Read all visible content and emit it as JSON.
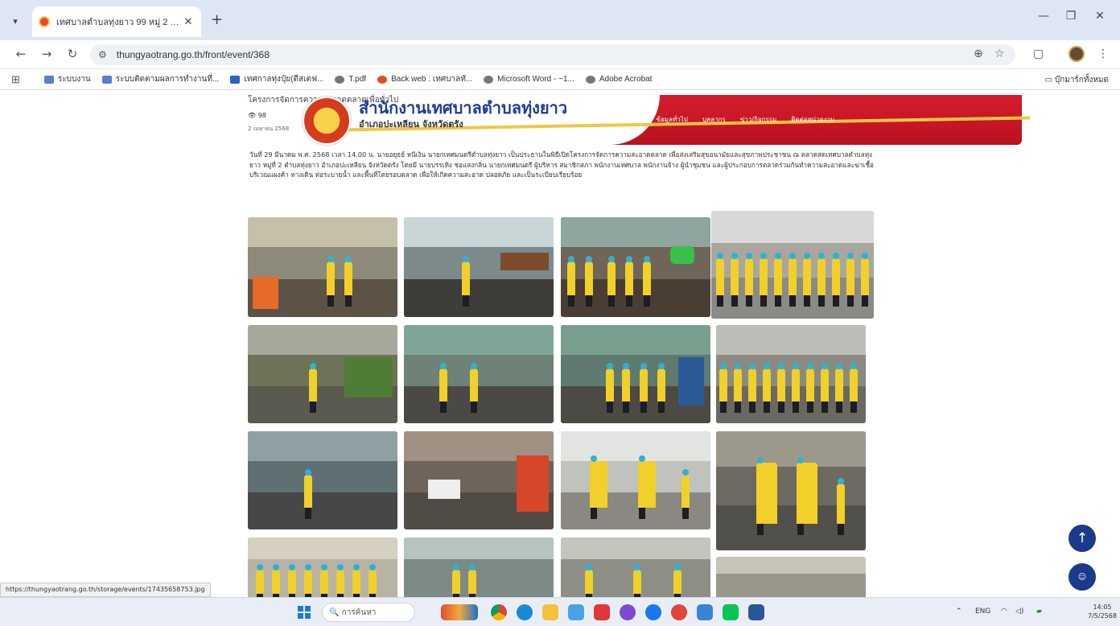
{
  "browser": {
    "tab_title": "เทศบาลตำบลทุ่งยาว 99 หมู่ 2 ถนน",
    "url": "thungyaotrang.go.th/front/event/368",
    "bookmarks": [
      "ระบบงาน",
      "ระบบติดตามผลการทำงานที่...",
      "เทศกาลทุ่งปุ๋ย(ดีสเตฟ...",
      "T.pdf",
      "Back web : เทศบาลทั...",
      "Microsoft Word - ~1...",
      "Adobe Acrobat"
    ],
    "all_bookmarks": "บุ๊กมาร์กทั้งหมด",
    "status_url": "https://thungyaotrang.go.th/storage/events/17435658753.jpg"
  },
  "page": {
    "org_title": "สำนักงานเทศบาลตำบลทุ่งยาว",
    "org_subtitle": "อำเภอปะเหลียน จังหวัดตรัง",
    "nav": [
      "หน้าแรก",
      "ข้อมูลทั่วไป",
      "บุคลากร",
      "ข่าว/กิจกรรม",
      "ติดต่อหน่วยงาน"
    ],
    "event_title": "โครงการจัดการความสะอาดตลาดเพื่อทั่วไป",
    "views": "98",
    "date": "2 เมษายน 2568",
    "body": "วันที่ 29 มีนาคม พ.ศ. 2568 เวลา 14.00 น. นายอยุธย์ หนีเงิน นายกเทศมนตรีตำบลทุ่งยาว เป็นประธานในพิธีเปิดโครงการจัดการความสะอาดตลาด เพื่อส่งเสริมสุขอนามัยและสุขภาพประชาชน ณ ตลาดสดเทศบาลตำบลทุ่งยาว หมู่ที่ 2 ตำบลทุ่งยาว อำเภอปะเหลียน จังหวัดตรัง โดยมี นายบรรเทิง ช่อแสงกลิ่น นายกเทศมนตรี ผู้บริหาร สมาชิกสภา พนักงานเทศบาล พนักงานจ้าง ผู้นำชุมชน และผู้ประกอบการตลาดร่วมกันทำความสะอาดและฆ่าเชื้อ บริเวณแผงค้า ทางเดิน ท่อระบายน้ำ และพื้นที่โดยรอบตลาด เพื่อให้เกิดความสะอาด ปลอดภัย และเป็นระเบียบเรียบร้อย"
  },
  "taskbar": {
    "search_placeholder": "การค้นหา",
    "lang": "ENG",
    "time": "14:05",
    "date": "7/5/2568"
  },
  "colors": {
    "brand_blue": "#1b3a8a",
    "banner_red": "#c8151f",
    "gold": "#f2c744"
  }
}
